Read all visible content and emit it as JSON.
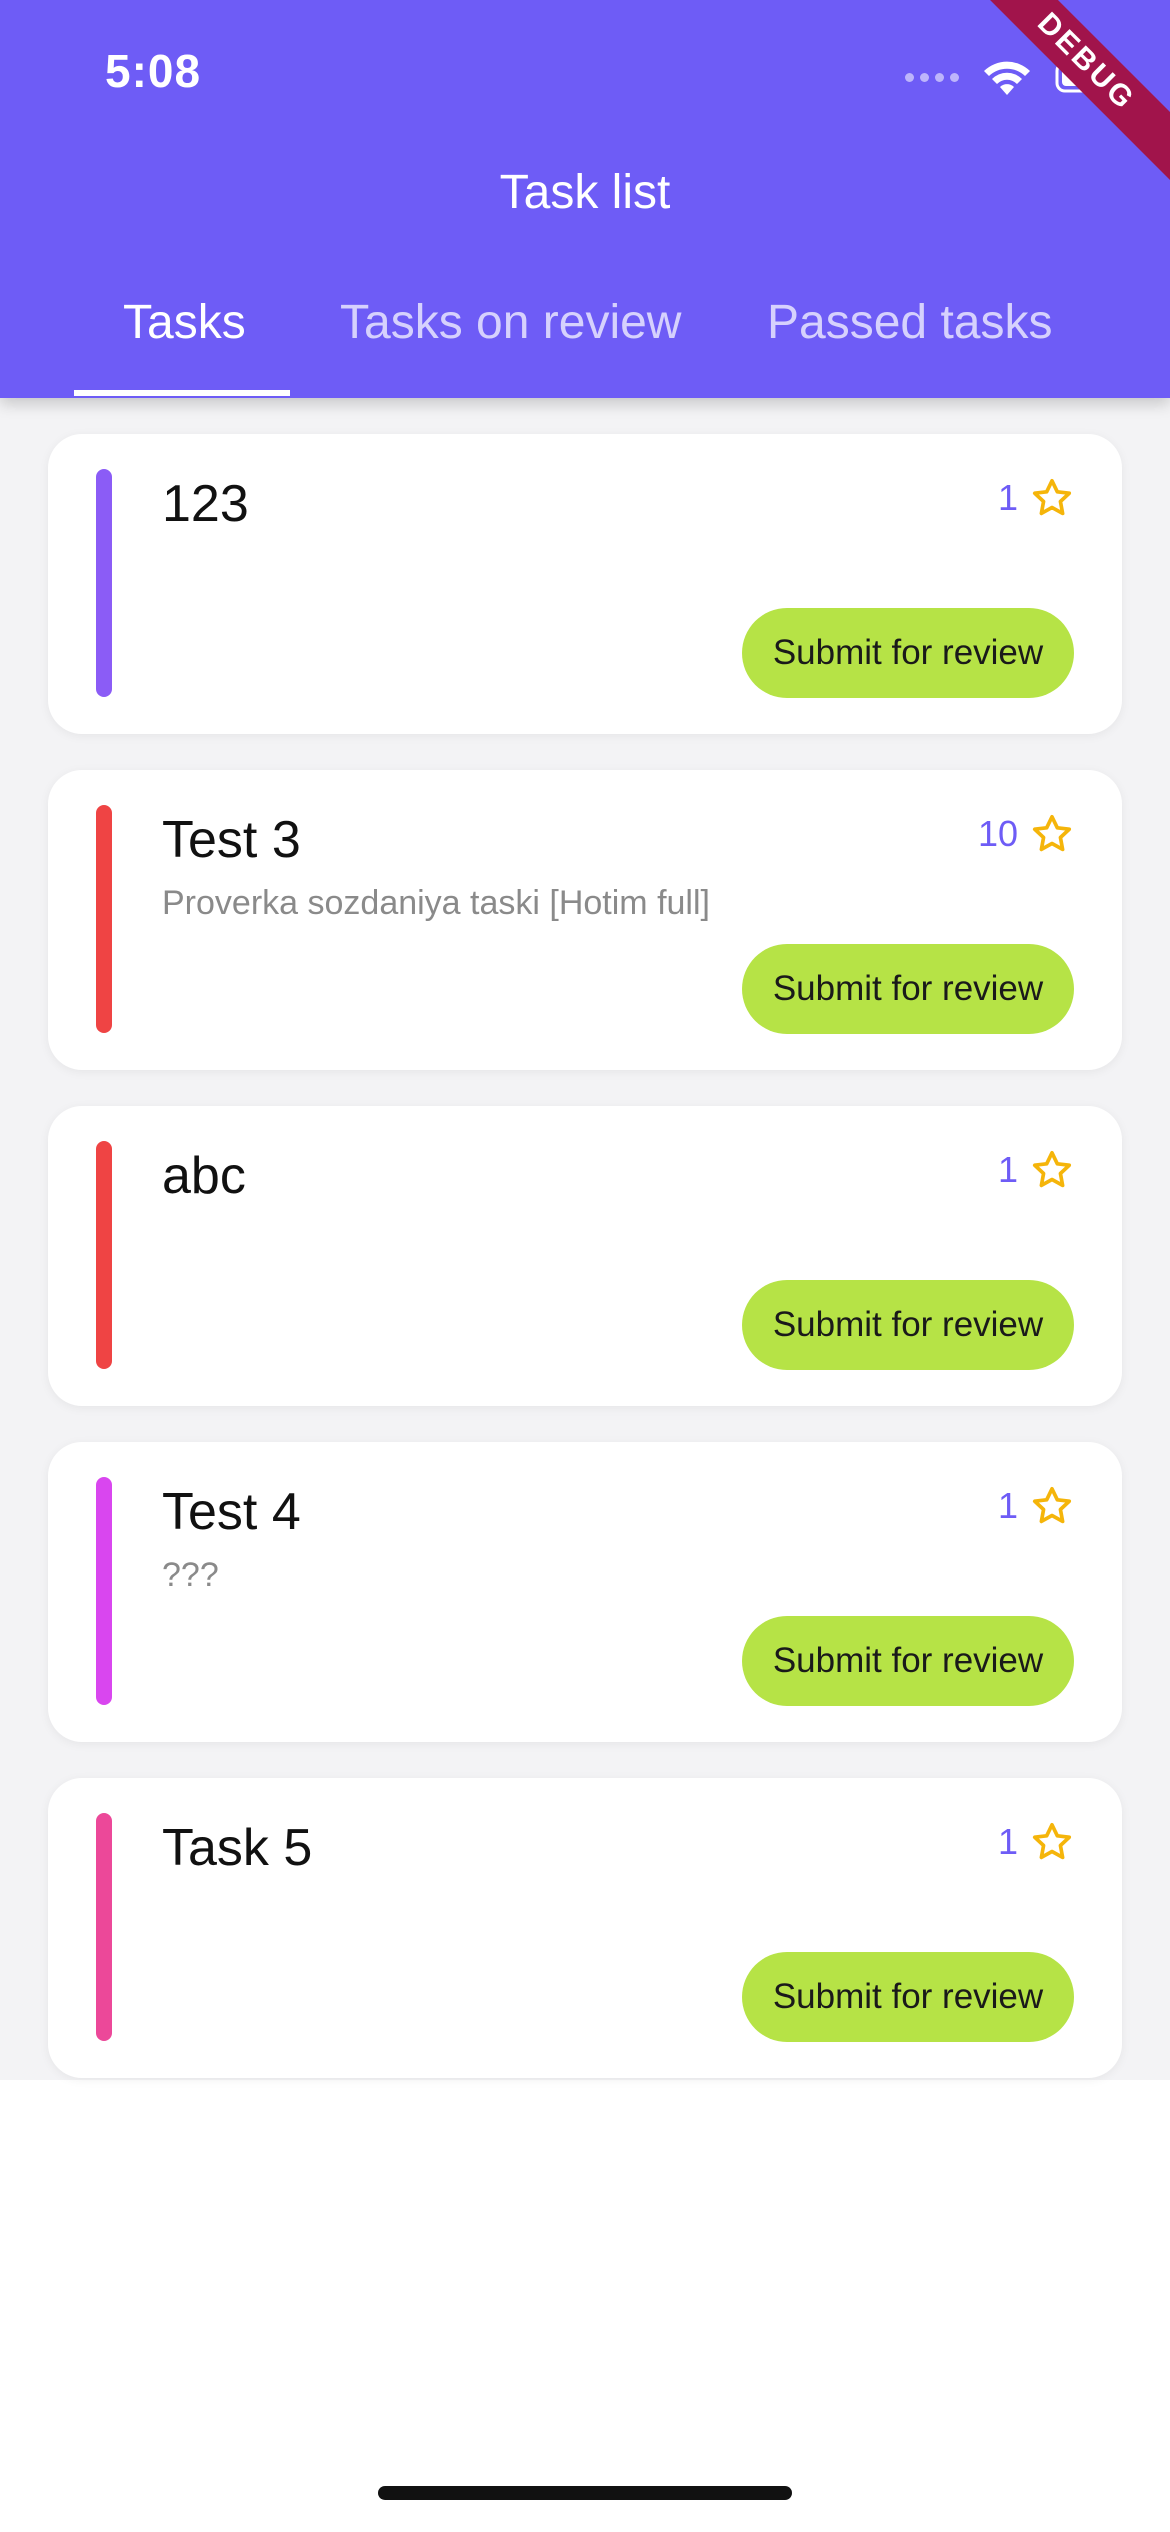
{
  "status_bar": {
    "time": "5:08",
    "debug_label": "DEBUG"
  },
  "app_bar": {
    "title": "Task list"
  },
  "tabs": [
    {
      "label": "Tasks",
      "active": true
    },
    {
      "label": "Tasks on review",
      "active": false
    },
    {
      "label": "Passed tasks",
      "active": false
    }
  ],
  "tasks": [
    {
      "title": "123",
      "description": "",
      "points": "1",
      "accent_color": "#8b5cf6",
      "action_label": "Submit for review"
    },
    {
      "title": "Test 3",
      "description": "Proverka sozdaniya taski [Hotim full]",
      "points": "10",
      "accent_color": "#ef4444",
      "action_label": "Submit for review"
    },
    {
      "title": "abc",
      "description": "",
      "points": "1",
      "accent_color": "#ef4444",
      "action_label": "Submit for review"
    },
    {
      "title": "Test 4",
      "description": "???",
      "points": "1",
      "accent_color": "#d946ef",
      "action_label": "Submit for review"
    },
    {
      "title": "Task 5",
      "description": "",
      "points": "1",
      "accent_color": "#ec4899",
      "action_label": "Submit for review"
    }
  ],
  "colors": {
    "primary": "#6e5cf6",
    "button": "#b6e346",
    "star": "#f5b50a"
  },
  "icons": {
    "star": "star-outline-icon",
    "wifi": "wifi-icon",
    "battery": "battery-icon",
    "signal": "signal-icon"
  }
}
